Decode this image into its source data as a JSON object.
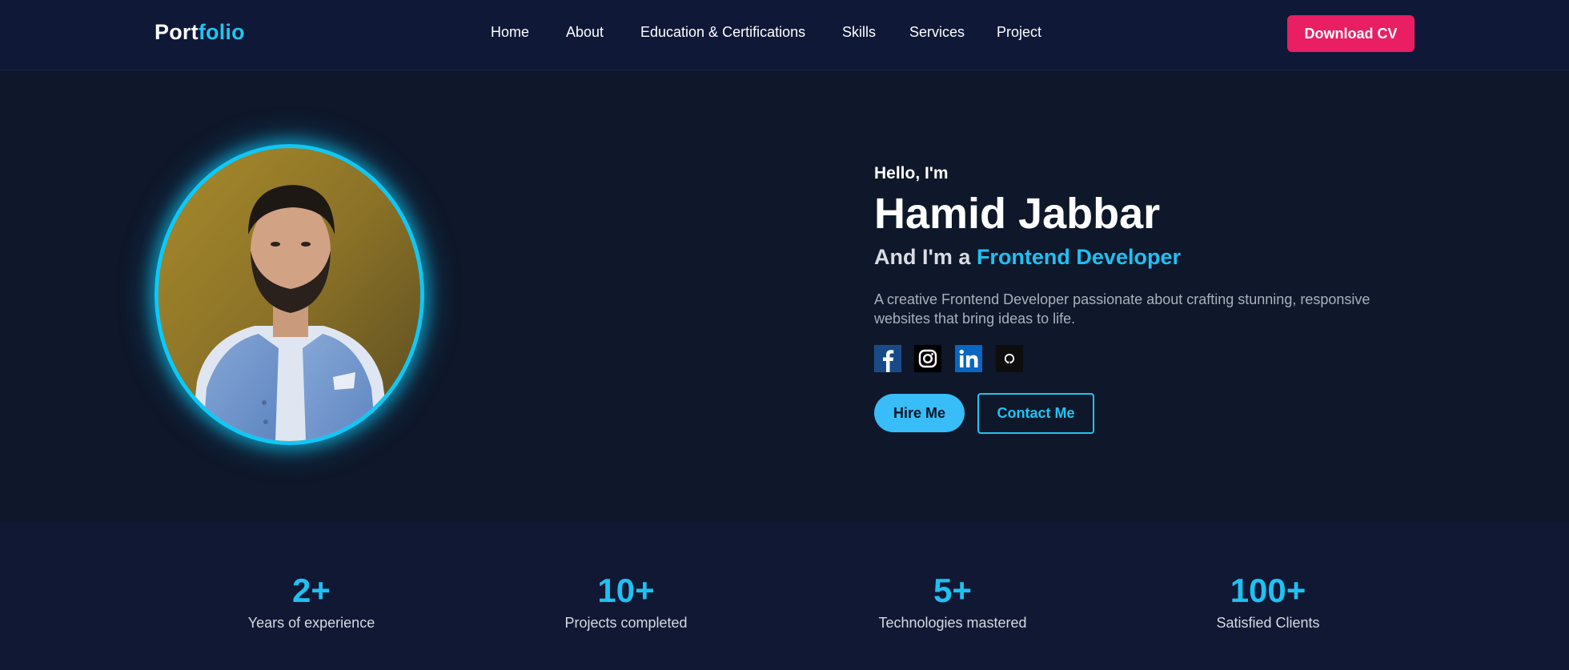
{
  "brand": {
    "part1": "Port",
    "part2": "folio",
    "accent_color": "#22c3f0"
  },
  "nav": {
    "links": [
      "Home",
      "About",
      "Education & Certifications",
      "Skills",
      "Services",
      "Project"
    ],
    "download_label": "Download CV",
    "download_color": "#e91e63"
  },
  "hero": {
    "greeting": "Hello, I'm",
    "name": "Hamid Jabbar",
    "role_prefix": "And I'm a ",
    "role_highlight": "Frontend Developer",
    "description": "A creative Frontend Developer passionate about crafting stunning, responsive websites that bring ideas to life.",
    "socials": [
      "facebook-icon",
      "instagram-icon",
      "linkedin-icon",
      "github-icon"
    ],
    "hire_label": "Hire Me",
    "contact_label": "Contact Me",
    "accent_color": "#1ec1f2",
    "glow_color": "#0fc8f5"
  },
  "stats": [
    {
      "value": "2+",
      "label": "Years of experience"
    },
    {
      "value": "10+",
      "label": "Projects completed"
    },
    {
      "value": "5+",
      "label": "Technologies mastered"
    },
    {
      "value": "100+",
      "label": "Satisfied Clients"
    }
  ]
}
